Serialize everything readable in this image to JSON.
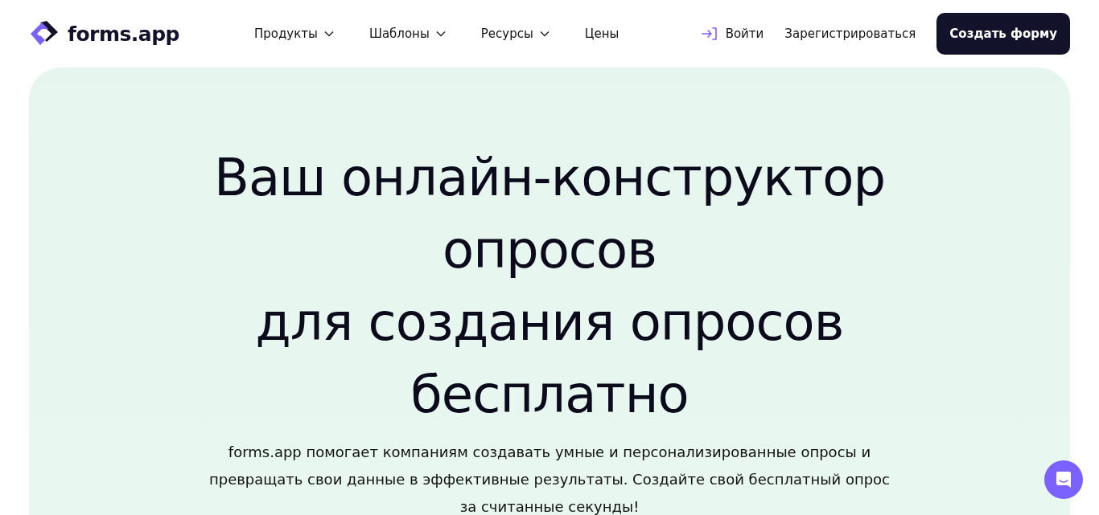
{
  "header": {
    "logo": "forms.app",
    "nav": [
      {
        "label": "Продукты",
        "kind": "dropdown"
      },
      {
        "label": "Шаблоны",
        "kind": "dropdown"
      },
      {
        "label": "Ресурсы",
        "kind": "dropdown"
      },
      {
        "label": "Цены",
        "kind": "link"
      }
    ],
    "login": "Войти",
    "signup": "Зарегистрироваться",
    "cta": "Создать форму"
  },
  "hero": {
    "heading": "Ваш онлайн-конструктор\nопросов\nдля создания опросов\nбесплатно",
    "description": "forms.app помогает компаниям создавать умные и персонализированные опросы и превращать свои данные в эффективные результаты. Создайте свой бесплатный опрос за считанные секунды!"
  }
}
